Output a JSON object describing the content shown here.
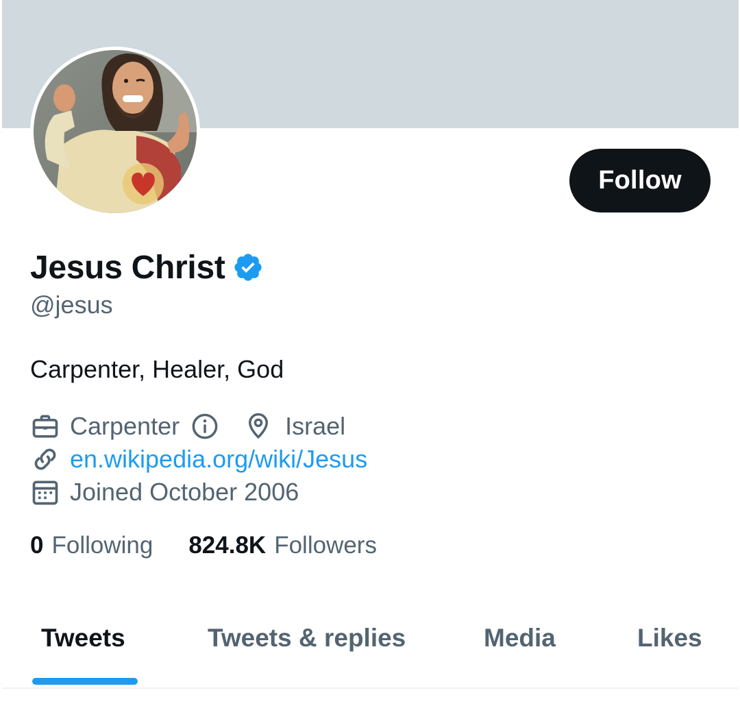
{
  "profile": {
    "display_name": "Jesus Christ",
    "handle": "@jesus",
    "bio": "Carpenter, Healer, God",
    "verified": true,
    "avatar_alt": "Profile photo"
  },
  "actions": {
    "follow_label": "Follow"
  },
  "meta": {
    "profession": "Carpenter",
    "location": "Israel",
    "website": "en.wikipedia.org/wiki/Jesus",
    "joined": "Joined October 2006"
  },
  "stats": {
    "following_count": "0",
    "following_label": "Following",
    "followers_count": "824.8K",
    "followers_label": "Followers"
  },
  "tabs": [
    {
      "label": "Tweets",
      "active": true
    },
    {
      "label": "Tweets & replies",
      "active": false
    },
    {
      "label": "Media",
      "active": false
    },
    {
      "label": "Likes",
      "active": false
    }
  ],
  "colors": {
    "banner": "#cfd9de",
    "accent": "#1d9bf0",
    "text_primary": "#0f1419",
    "text_secondary": "#536471",
    "button_bg": "#0f1419"
  },
  "icons": {
    "verified": "verified-badge-icon",
    "profession": "briefcase-icon",
    "info": "info-icon",
    "location": "location-pin-icon",
    "website": "link-icon",
    "joined": "calendar-icon"
  }
}
